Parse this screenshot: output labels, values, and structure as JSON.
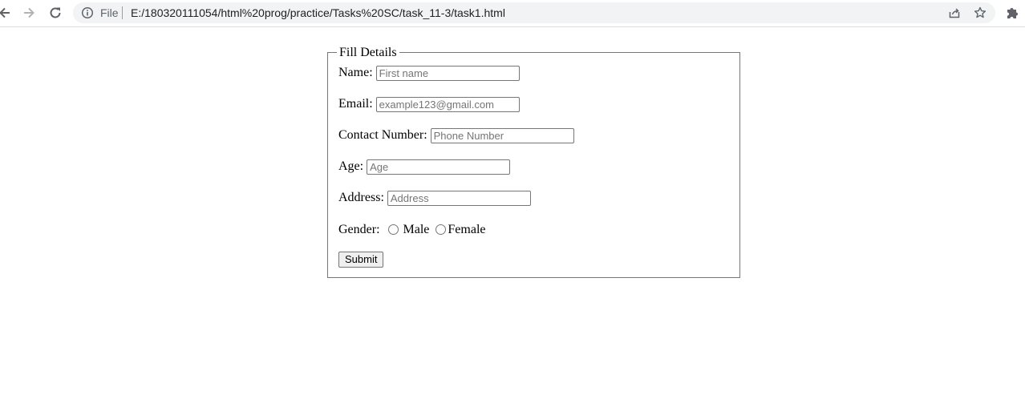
{
  "browser": {
    "file_label": "File",
    "url": "E:/180320111054/html%20prog/practice/Tasks%20SC/task_11-3/task1.html"
  },
  "form": {
    "legend": "Fill Details",
    "name_label": "Name:",
    "name_placeholder": "First name",
    "email_label": "Email:",
    "email_placeholder": "example123@gmail.com",
    "contact_label": "Contact Number:",
    "contact_placeholder": "Phone Number",
    "age_label": "Age:",
    "age_placeholder": "Age",
    "address_label": "Address:",
    "address_placeholder": "Address",
    "gender_label": "Gender:",
    "gender_options": [
      "Male",
      "Female"
    ],
    "submit_label": "Submit"
  }
}
